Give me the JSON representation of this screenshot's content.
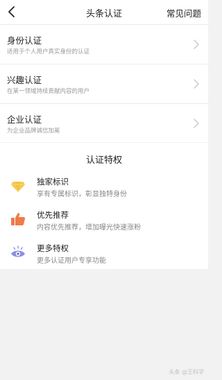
{
  "nav": {
    "title": "头条认证",
    "right_link": "常见问题"
  },
  "list": {
    "items": [
      {
        "title": "身份认证",
        "desc": "适用于个人用户真实身份的认证"
      },
      {
        "title": "兴趣认证",
        "desc": "在某一领域持续贡献内容的用户"
      },
      {
        "title": "企业认证",
        "desc": "为企业品牌诚信加冕"
      }
    ]
  },
  "perks": {
    "title": "认证特权",
    "items": [
      {
        "title": "独家标识",
        "desc": "享有专属标识，彰显独特身份",
        "icon": "diamond-icon"
      },
      {
        "title": "优先推荐",
        "desc": "内容优先推荐，增加曝光快速涨粉",
        "icon": "thumbs-up-icon"
      },
      {
        "title": "更多特权",
        "desc": "更多认证用户专享功能",
        "icon": "eye-icon"
      }
    ]
  },
  "watermark": "头条 @王科学",
  "colors": {
    "diamond": "#f5c242",
    "thumb": "#f07a4a",
    "eye": "#8c8fe0"
  }
}
